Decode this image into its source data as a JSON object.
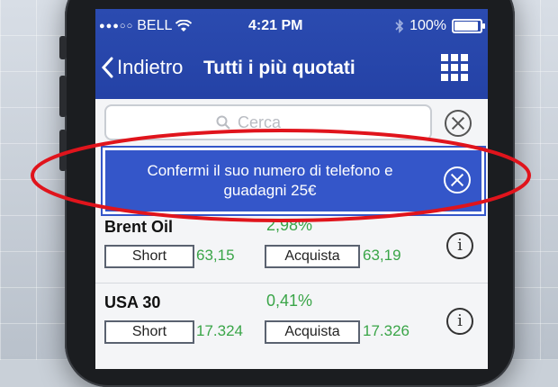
{
  "status_bar": {
    "carrier": "BELL",
    "time": "4:21 PM",
    "battery": "100%",
    "battery_level": 1.0
  },
  "nav": {
    "back_label": "Indietro",
    "title": "Tutti i più quotati"
  },
  "search": {
    "placeholder": "Cerca"
  },
  "banner": {
    "message": "Confermi il suo numero di telefono e guadagni 25€"
  },
  "instruments": [
    {
      "name": "Brent Oil",
      "change": "2,98%",
      "short_label": "Short",
      "short_price": "63,15",
      "buy_label": "Acquista",
      "buy_price": "63,19"
    },
    {
      "name": "USA 30",
      "change": "0,41%",
      "short_label": "Short",
      "short_price": "17.324",
      "buy_label": "Acquista",
      "buy_price": "17.326"
    }
  ],
  "colors": {
    "nav_blue": "#2442a6",
    "banner_blue": "#3456c9",
    "positive_green": "#3aa548",
    "annotation_red": "#e0141c"
  }
}
